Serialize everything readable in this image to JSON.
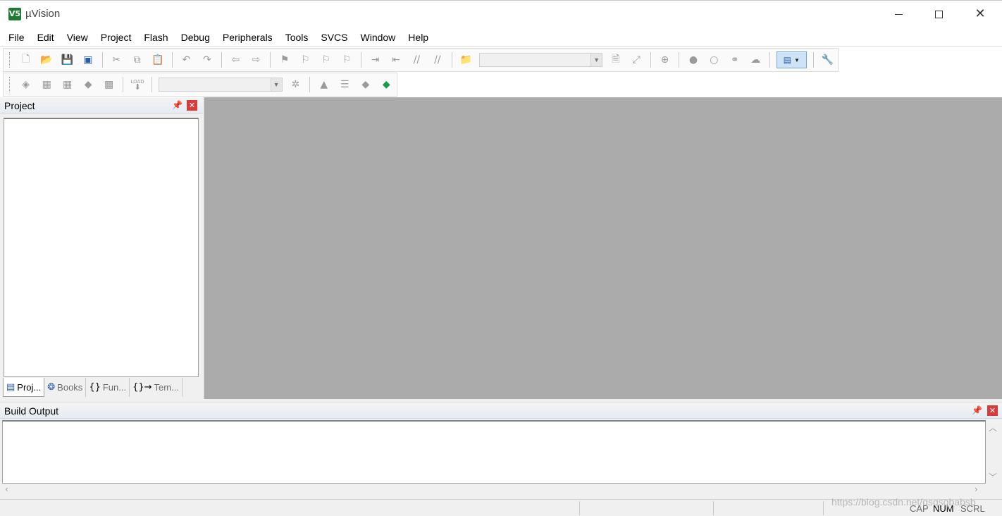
{
  "window": {
    "title": "µVision",
    "app_icon": "V5"
  },
  "menu": [
    "File",
    "Edit",
    "View",
    "Project",
    "Flash",
    "Debug",
    "Peripherals",
    "Tools",
    "SVCS",
    "Window",
    "Help"
  ],
  "toolbar1": {
    "icons": [
      "new-file-icon",
      "open-file-icon",
      "save-icon",
      "save-all-icon",
      "cut-icon",
      "copy-icon",
      "paste-icon",
      "undo-icon",
      "redo-icon",
      "navigate-back-icon",
      "navigate-forward-icon",
      "bookmark-icon",
      "bookmark-prev-icon",
      "bookmark-next-icon",
      "bookmark-clear-icon",
      "indent-icon",
      "unindent-icon",
      "comment-icon",
      "uncomment-icon",
      "find-in-files-icon",
      "find-icon",
      "incremental-find-icon",
      "debug-icon",
      "breakpoint-icon",
      "breakpoint-disable-icon",
      "breakpoint-enable-all-icon",
      "breakpoint-kill-all-icon",
      "window-layout-icon",
      "configure-icon"
    ],
    "find_combo_value": ""
  },
  "toolbar2": {
    "icons": [
      "translate-icon",
      "build-icon",
      "rebuild-icon",
      "batch-build-icon",
      "stop-build-icon",
      "download-icon",
      "options-for-target-icon",
      "manage-project-items-icon",
      "select-packs-icon",
      "manage-runtime-icon",
      "pack-installer-icon"
    ],
    "target_combo_value": "",
    "load_label": "LOAD"
  },
  "project_panel": {
    "title": "Project",
    "tabs": [
      {
        "label": "Proj...",
        "icon": "project-tab-icon"
      },
      {
        "label": "Books",
        "icon": "books-tab-icon"
      },
      {
        "label": "Fun...",
        "icon": "functions-tab-icon"
      },
      {
        "label": "Tem...",
        "icon": "templates-tab-icon"
      }
    ]
  },
  "build_output": {
    "title": "Build Output",
    "content": ""
  },
  "status_bar": {
    "cap": "CAP",
    "num": "NUM",
    "scrl": "SCRL"
  },
  "watermark": "https://blog.csdn.net/qsqsqbabsb",
  "colors": {
    "editor_bg": "#ababab",
    "close_red": "#d93a3a",
    "panel_head": "#e6ecf3"
  }
}
